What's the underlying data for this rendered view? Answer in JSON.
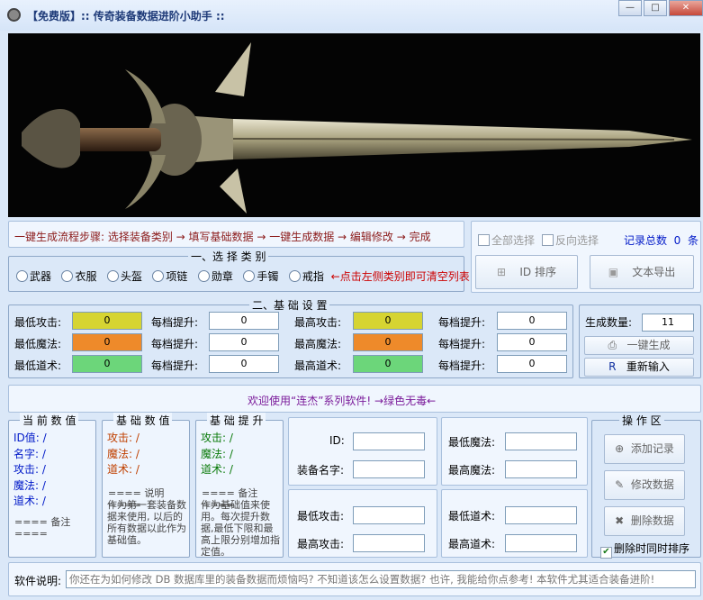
{
  "window": {
    "title": "【免费版】:: 传奇装备数据进阶小助手 ::",
    "minimize": "—",
    "maximize": "□",
    "close": "✕"
  },
  "flow": {
    "text": "一键生成流程步骤: 选择装备类别 → 填写基础数据 → 一键生成数据 → 编辑修改 → 完成"
  },
  "category": {
    "title": "一、选 择 类 别",
    "options": [
      "武器",
      "衣服",
      "头盔",
      "项链",
      "勋章",
      "手镯",
      "戒指"
    ],
    "hint": "←点击左侧类别即可清空列表"
  },
  "records": {
    "select_all": "全部选择",
    "invert": "反向选择",
    "total_label": "记录总数",
    "total_value": "0",
    "unit": "条",
    "id_sort": "ID 排序",
    "export": "文本导出"
  },
  "basic": {
    "title": "二、基 础 设 置",
    "rows": [
      {
        "min_label": "最低攻击:",
        "min_value": "0",
        "min_color": "#d6d432",
        "step1_label": "每档提升:",
        "step1_value": "0",
        "max_label": "最高攻击:",
        "max_value": "0",
        "max_color": "#d6d432",
        "step2_label": "每档提升:",
        "step2_value": "0"
      },
      {
        "min_label": "最低魔法:",
        "min_value": "0",
        "min_color": "#ee8a2a",
        "step1_label": "每档提升:",
        "step1_value": "0",
        "max_label": "最高魔法:",
        "max_value": "0",
        "max_color": "#ee8a2a",
        "step2_label": "每档提升:",
        "step2_value": "0"
      },
      {
        "min_label": "最低道术:",
        "min_value": "0",
        "min_color": "#6cd67a",
        "step1_label": "每档提升:",
        "step1_value": "0",
        "max_label": "最高道术:",
        "max_value": "0",
        "max_color": "#6cd67a",
        "step2_label": "每档提升:",
        "step2_value": "0"
      }
    ]
  },
  "generate": {
    "count_label": "生成数量:",
    "count_value": "11",
    "one_key": "一键生成",
    "reset": "重新输入"
  },
  "welcome": {
    "text": "欢迎使用“连杰”系列软件! →绿色无毒←"
  },
  "current": {
    "title": "当 前 数 值",
    "lines": [
      "ID值: /",
      "名字: /",
      "攻击: /",
      "魔法: /",
      "道术: /"
    ],
    "note": "==== 备注 ===="
  },
  "base_values": {
    "title": "基 础 数 值",
    "lines": [
      "攻击: /",
      "魔法: /",
      "道术: /"
    ],
    "note_title": "==== 说明 ====",
    "note": "作为第一套装备数据来使用, 以后的所有数据以此作为基础值。"
  },
  "increments": {
    "title": "基 础 提 升",
    "lines": [
      "攻击: /",
      "魔法: /",
      "道术: /"
    ],
    "note_title": "==== 备注 ====",
    "note": "作为基础值来使用。每次提升数据,最低下限和最高上限分别增加指定值。"
  },
  "edit": {
    "id": "ID:",
    "name": "装备名字:",
    "min_magic": "最低魔法:",
    "max_magic": "最高魔法:",
    "min_attack": "最低攻击:",
    "max_attack": "最高攻击:",
    "min_tao": "最低道术:",
    "max_tao": "最高道术:"
  },
  "ops": {
    "title": "操 作 区",
    "add": "添加记录",
    "modify": "修改数据",
    "delete": "删除数据",
    "sync_delete": "删除时同时排序"
  },
  "help": {
    "label": "软件说明:",
    "text": "你还在为如何修改 DB 数据库里的装备数据而烦恼吗? 不知道该怎么设置数据? 也许, 我能给你点参考! 本软件尤其适合装备进阶!"
  }
}
